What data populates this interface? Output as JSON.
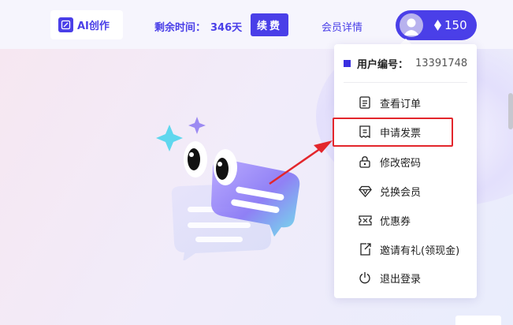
{
  "header": {
    "ai_create_label": "AI创作",
    "remaining_label": "剩余时间：",
    "remaining_value": "346天",
    "renew_label": "续费",
    "member_detail_label": "会员详情",
    "balance": "150"
  },
  "menu": {
    "user_id_label": "用户编号：",
    "user_id_value": "13391748",
    "items": [
      {
        "label": "查看订单",
        "icon": "order-icon"
      },
      {
        "label": "申请发票",
        "icon": "invoice-icon"
      },
      {
        "label": "修改密码",
        "icon": "lock-icon"
      },
      {
        "label": "兑换会员",
        "icon": "diamond-outline-icon"
      },
      {
        "label": "优惠券",
        "icon": "coupon-icon"
      },
      {
        "label": "邀请有礼(领现金)",
        "icon": "share-icon"
      },
      {
        "label": "退出登录",
        "icon": "power-icon"
      }
    ]
  },
  "colors": {
    "accent": "#4a3fe8",
    "highlight": "#e3262c"
  }
}
